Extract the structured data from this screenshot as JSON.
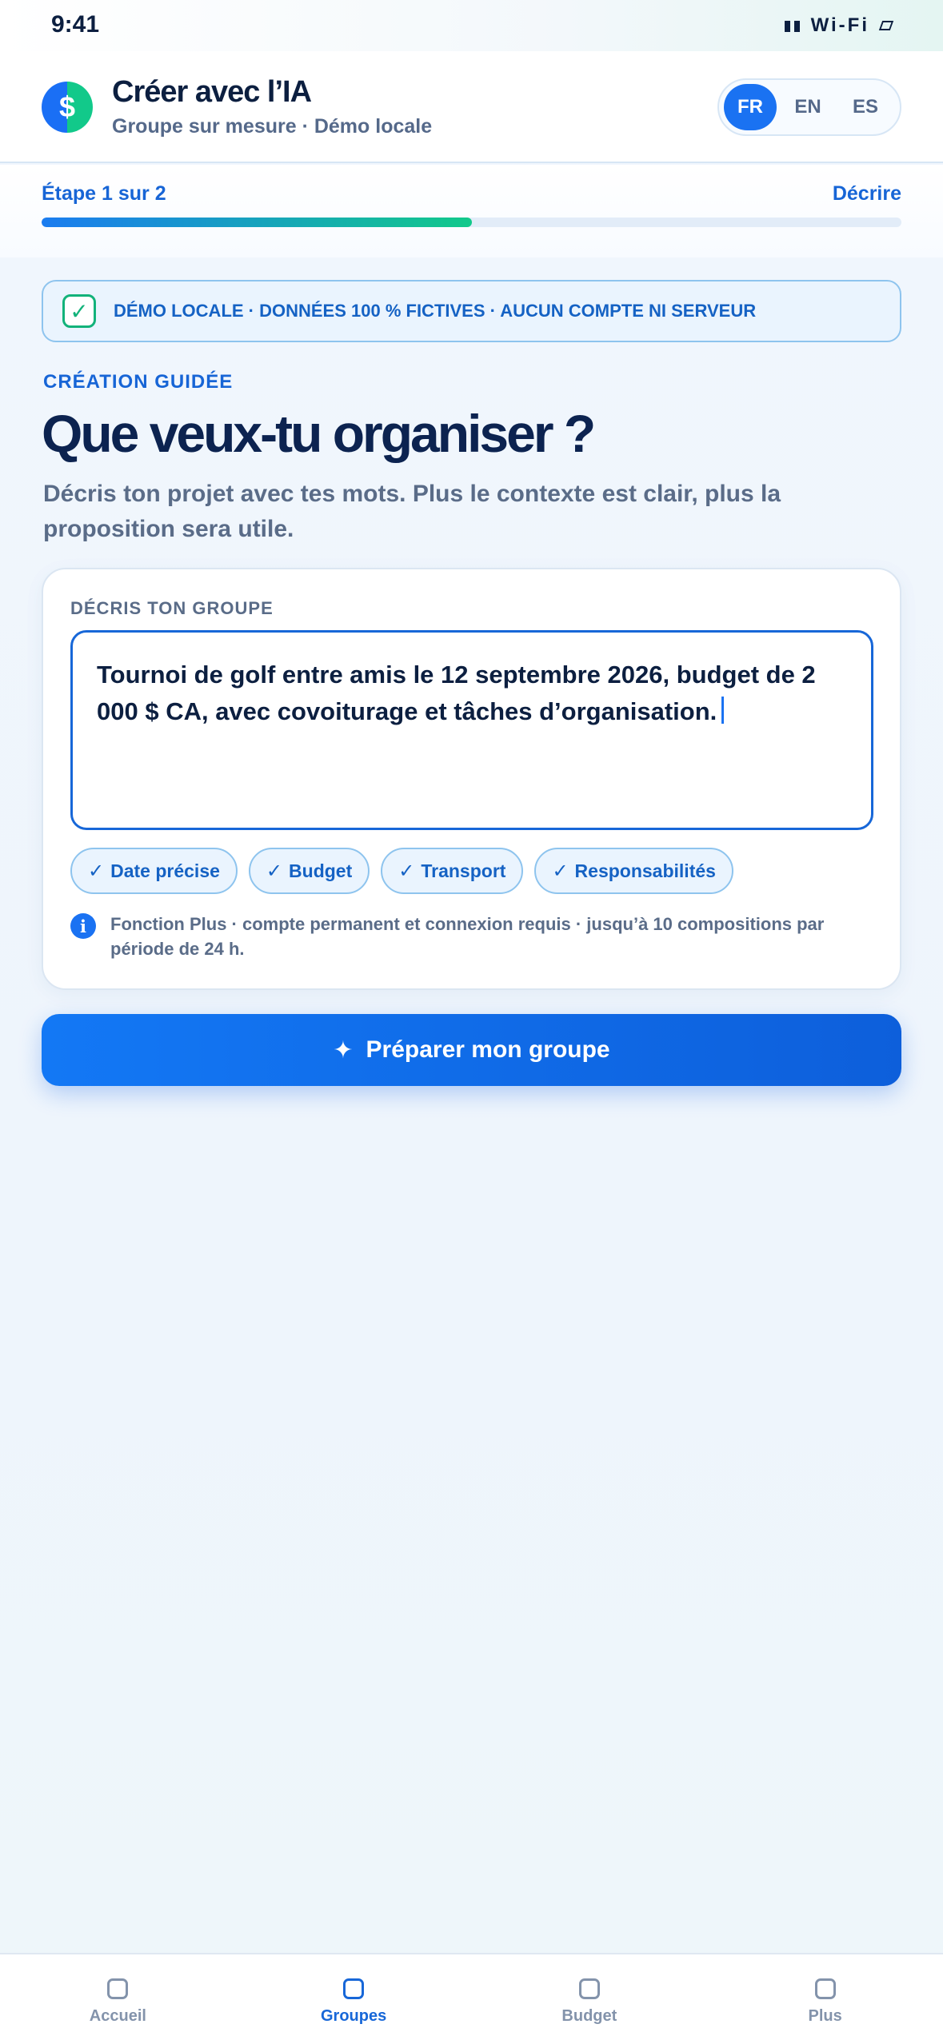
{
  "status_bar": {
    "time": "9:41",
    "network": "Wi-Fi"
  },
  "header": {
    "logo_symbol": "$",
    "title": "Créer avec l’IA",
    "subtitle": "Groupe sur mesure · Démo locale",
    "languages": [
      "FR",
      "EN",
      "ES"
    ],
    "selected_language": "FR"
  },
  "progress": {
    "step_label": "Étape 1 sur 2",
    "step_name": "Décrire",
    "fraction": 0.5
  },
  "banner": {
    "text": "DÉMO LOCALE · DONNÉES 100 % FICTIVES · AUCUN COMPTE NI SERVEUR"
  },
  "intro": {
    "eyebrow": "CRÉATION GUIDÉE",
    "title": "Que veux-tu organiser ?",
    "description": "Décris ton projet avec tes mots. Plus le contexte est clair, plus la proposition sera utile."
  },
  "card": {
    "label": "DÉCRIS TON GROUPE",
    "textarea_value": "Tournoi de golf entre amis le 12 septembre 2026, budget de 2 000 $ CA, avec covoiturage et tâches d’organisation.",
    "chips": [
      "Date précise",
      "Budget",
      "Transport",
      "Responsabilités"
    ],
    "info": "Fonction Plus · compte permanent et connexion requis · jusqu’à 10 compositions par période de 24 h."
  },
  "primary_button": {
    "label": "Préparer mon groupe",
    "icon": "sparkle-icon"
  },
  "tab_bar": {
    "tabs": [
      "Accueil",
      "Groupes",
      "Budget",
      "Plus"
    ],
    "active": "Groupes"
  },
  "colors": {
    "accent": "#1a72f2",
    "success": "#12c98a",
    "title": "#0c2350",
    "muted": "#5a6c88"
  }
}
